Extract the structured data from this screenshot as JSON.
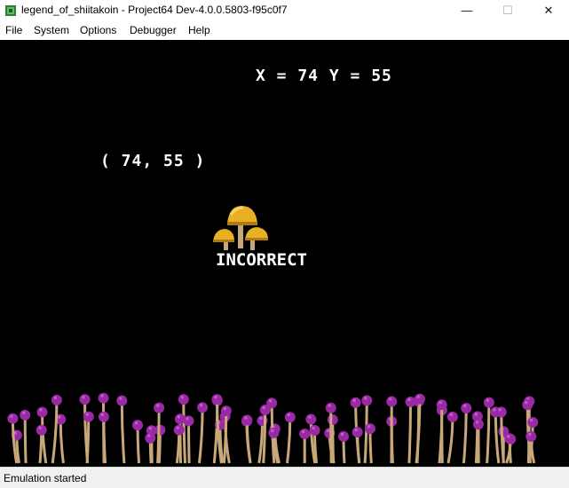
{
  "window": {
    "title": "legend_of_shiitakoin - Project64 Dev-4.0.0.5803-f95c0f7",
    "controls": {
      "minimize": "—",
      "maximize": "☐",
      "close": "✕"
    }
  },
  "menu": [
    "File",
    "System",
    "Options",
    "Debugger",
    "Help"
  ],
  "game": {
    "coord_readout": "X = 74 Y = 55",
    "coord_pair": "( 74, 55 )",
    "verdict": "INCORRECT",
    "mushroom_icon": "golden-mushroom-icon",
    "garden_icon": "purple-mushroom-field"
  },
  "status": {
    "text": "Emulation started"
  },
  "colors": {
    "screen_bg": "#000000",
    "mushroom_gold": "#e8b024",
    "stem": "#c8a878",
    "purple_cap": "#9a2aa4"
  }
}
